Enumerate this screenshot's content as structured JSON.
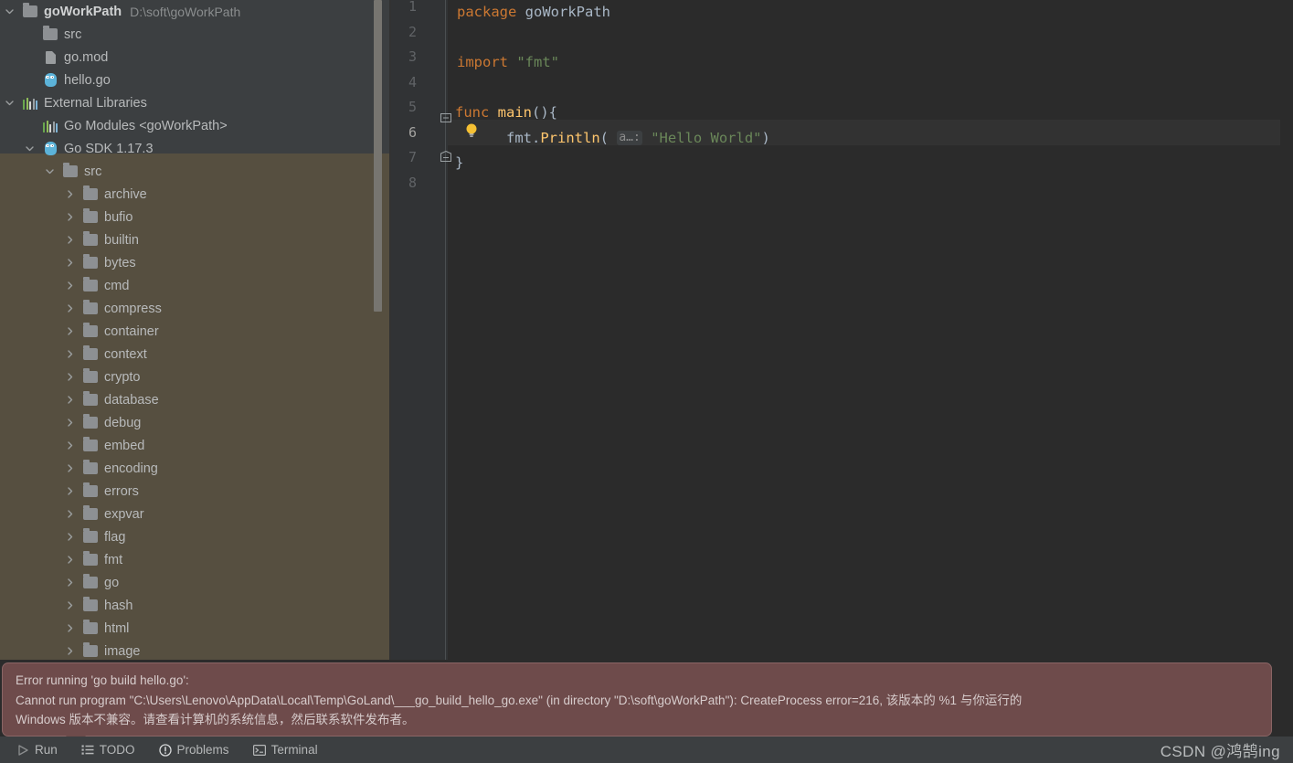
{
  "project_tree": {
    "items": [
      {
        "label": "goWorkPath",
        "path_suffix": "D:\\soft\\goWorkPath",
        "icon": "folder-icon",
        "arrow": "chevron-down",
        "indent": 0,
        "bold": true,
        "selected": false
      },
      {
        "label": "src",
        "path_suffix": "",
        "icon": "folder-icon",
        "arrow": "none",
        "indent": 1,
        "bold": false,
        "selected": false
      },
      {
        "label": "go.mod",
        "path_suffix": "",
        "icon": "document-icon",
        "arrow": "none",
        "indent": 1,
        "bold": false,
        "selected": false
      },
      {
        "label": "hello.go",
        "path_suffix": "",
        "icon": "go-file-icon",
        "arrow": "none",
        "indent": 1,
        "bold": false,
        "selected": false
      },
      {
        "label": "External Libraries",
        "path_suffix": "",
        "icon": "libraries-icon",
        "arrow": "chevron-down",
        "indent": 0,
        "bold": false,
        "selected": false
      },
      {
        "label": "Go Modules <goWorkPath>",
        "path_suffix": "",
        "icon": "libraries-icon",
        "arrow": "none",
        "indent": 1,
        "bold": false,
        "selected": false
      },
      {
        "label": "Go SDK 1.17.3",
        "path_suffix": "",
        "icon": "go-file-icon",
        "arrow": "chevron-down",
        "indent": 1,
        "bold": false,
        "selected": false
      },
      {
        "label": "src",
        "path_suffix": "",
        "icon": "folder-icon",
        "arrow": "chevron-down",
        "indent": 2,
        "bold": false,
        "selected": true
      },
      {
        "label": "archive",
        "path_suffix": "",
        "icon": "folder-icon",
        "arrow": "chevron-right",
        "indent": 3,
        "bold": false,
        "selected": true
      },
      {
        "label": "bufio",
        "path_suffix": "",
        "icon": "folder-icon",
        "arrow": "chevron-right",
        "indent": 3,
        "bold": false,
        "selected": true
      },
      {
        "label": "builtin",
        "path_suffix": "",
        "icon": "folder-icon",
        "arrow": "chevron-right",
        "indent": 3,
        "bold": false,
        "selected": true
      },
      {
        "label": "bytes",
        "path_suffix": "",
        "icon": "folder-icon",
        "arrow": "chevron-right",
        "indent": 3,
        "bold": false,
        "selected": true
      },
      {
        "label": "cmd",
        "path_suffix": "",
        "icon": "folder-icon",
        "arrow": "chevron-right",
        "indent": 3,
        "bold": false,
        "selected": true
      },
      {
        "label": "compress",
        "path_suffix": "",
        "icon": "folder-icon",
        "arrow": "chevron-right",
        "indent": 3,
        "bold": false,
        "selected": true
      },
      {
        "label": "container",
        "path_suffix": "",
        "icon": "folder-icon",
        "arrow": "chevron-right",
        "indent": 3,
        "bold": false,
        "selected": true
      },
      {
        "label": "context",
        "path_suffix": "",
        "icon": "folder-icon",
        "arrow": "chevron-right",
        "indent": 3,
        "bold": false,
        "selected": true
      },
      {
        "label": "crypto",
        "path_suffix": "",
        "icon": "folder-icon",
        "arrow": "chevron-right",
        "indent": 3,
        "bold": false,
        "selected": true
      },
      {
        "label": "database",
        "path_suffix": "",
        "icon": "folder-icon",
        "arrow": "chevron-right",
        "indent": 3,
        "bold": false,
        "selected": true
      },
      {
        "label": "debug",
        "path_suffix": "",
        "icon": "folder-icon",
        "arrow": "chevron-right",
        "indent": 3,
        "bold": false,
        "selected": true
      },
      {
        "label": "embed",
        "path_suffix": "",
        "icon": "folder-icon",
        "arrow": "chevron-right",
        "indent": 3,
        "bold": false,
        "selected": true
      },
      {
        "label": "encoding",
        "path_suffix": "",
        "icon": "folder-icon",
        "arrow": "chevron-right",
        "indent": 3,
        "bold": false,
        "selected": true
      },
      {
        "label": "errors",
        "path_suffix": "",
        "icon": "folder-icon",
        "arrow": "chevron-right",
        "indent": 3,
        "bold": false,
        "selected": true
      },
      {
        "label": "expvar",
        "path_suffix": "",
        "icon": "folder-icon",
        "arrow": "chevron-right",
        "indent": 3,
        "bold": false,
        "selected": true
      },
      {
        "label": "flag",
        "path_suffix": "",
        "icon": "folder-icon",
        "arrow": "chevron-right",
        "indent": 3,
        "bold": false,
        "selected": true
      },
      {
        "label": "fmt",
        "path_suffix": "",
        "icon": "folder-icon",
        "arrow": "chevron-right",
        "indent": 3,
        "bold": false,
        "selected": true
      },
      {
        "label": "go",
        "path_suffix": "",
        "icon": "folder-icon",
        "arrow": "chevron-right",
        "indent": 3,
        "bold": false,
        "selected": true
      },
      {
        "label": "hash",
        "path_suffix": "",
        "icon": "folder-icon",
        "arrow": "chevron-right",
        "indent": 3,
        "bold": false,
        "selected": true
      },
      {
        "label": "html",
        "path_suffix": "",
        "icon": "folder-icon",
        "arrow": "chevron-right",
        "indent": 3,
        "bold": false,
        "selected": true
      },
      {
        "label": "image",
        "path_suffix": "",
        "icon": "folder-icon",
        "arrow": "chevron-right",
        "indent": 3,
        "bold": false,
        "selected": true
      }
    ]
  },
  "editor": {
    "line_numbers": [
      "1",
      "2",
      "3",
      "4",
      "5",
      "6",
      "7",
      "8"
    ],
    "current_line": 6,
    "lines": [
      {
        "n": 1,
        "segments": [
          {
            "t": "package",
            "c": "kw"
          },
          {
            "t": " ",
            "c": "plain"
          },
          {
            "t": "goWorkPath",
            "c": "pkg"
          }
        ]
      },
      {
        "n": 2,
        "segments": []
      },
      {
        "n": 3,
        "segments": [
          {
            "t": "import",
            "c": "kw"
          },
          {
            "t": " ",
            "c": "plain"
          },
          {
            "t": "\"fmt\"",
            "c": "str"
          }
        ]
      },
      {
        "n": 4,
        "segments": []
      },
      {
        "n": 5,
        "segments": [
          {
            "t": "func",
            "c": "kw"
          },
          {
            "t": " ",
            "c": "plain"
          },
          {
            "t": "main",
            "c": "fn"
          },
          {
            "t": "(){",
            "c": "punct"
          }
        ]
      },
      {
        "n": 6,
        "segments": []
      },
      {
        "n": 7,
        "segments": [
          {
            "t": "}",
            "c": "punct"
          }
        ]
      },
      {
        "n": 8,
        "segments": []
      }
    ],
    "line6": {
      "indent": "    ",
      "receiver": "fmt",
      "dot": ".",
      "method": "Println",
      "open_paren": "(",
      "param_hint": "a…:",
      "arg": "\"Hello World\"",
      "close_paren": ")"
    },
    "fold_markers": [
      {
        "line": 5,
        "type": "fold-open-icon"
      },
      {
        "line": 7,
        "type": "fold-close-icon"
      }
    ],
    "bulb_icon": "intention-bulb-icon"
  },
  "error_balloon": {
    "title": "Error running 'go build hello.go':",
    "line2": "Cannot run program \"C:\\Users\\Lenovo\\AppData\\Local\\Temp\\GoLand\\___go_build_hello_go.exe\" (in directory \"D:\\soft\\goWorkPath\"): CreateProcess error=216, 该版本的 %1 与你运行的",
    "line3": "Windows 版本不兼容。请查看计算机的系统信息，然后联系软件发布者。"
  },
  "status_bar": {
    "tabs": [
      {
        "label": "Run",
        "icon": "run-play-icon"
      },
      {
        "label": "TODO",
        "icon": "todo-list-icon"
      },
      {
        "label": "Problems",
        "icon": "problems-warning-icon"
      },
      {
        "label": "Terminal",
        "icon": "terminal-icon"
      }
    ]
  },
  "watermark": {
    "text": "CSDN @鸿鹄ing"
  },
  "colors": {
    "sidebar_bg": "#3c3f41",
    "sidebar_selection": "#564f40",
    "editor_bg": "#2b2b2b",
    "gutter_bg": "#313335",
    "current_line": "#323232",
    "error_balloon_bg": "#6e4b4b",
    "error_balloon_border": "#8a6565",
    "keyword": "#cc7832",
    "string": "#6a8759",
    "function": "#ffc66d",
    "default_text": "#a9b7c6",
    "go_blue": "#5cb3d9"
  }
}
